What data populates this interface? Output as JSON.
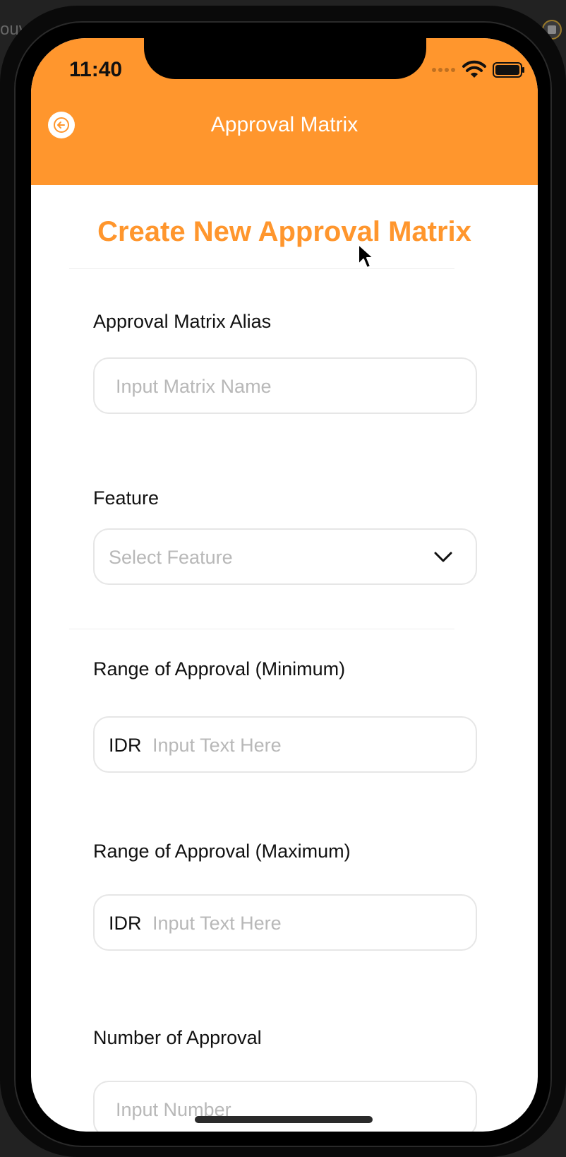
{
  "desktop": {
    "partial_text": "ouv"
  },
  "status_bar": {
    "time": "11:40"
  },
  "header": {
    "title": "Approval Matrix",
    "back_icon": "arrow-left-icon",
    "background_color": "#FF962D"
  },
  "page": {
    "title": "Create New Approval Matrix",
    "accent_color": "#FF962D"
  },
  "form": {
    "alias": {
      "label": "Approval Matrix Alias",
      "placeholder": "Input Matrix Name",
      "value": ""
    },
    "feature": {
      "label": "Feature",
      "placeholder": "Select Feature",
      "icon": "chevron-down-icon",
      "selected": ""
    },
    "range_min": {
      "label": "Range of Approval (Minimum)",
      "prefix": "IDR",
      "placeholder": "Input Text Here",
      "value": ""
    },
    "range_max": {
      "label": "Range of Approval (Maximum)",
      "prefix": "IDR",
      "placeholder": "Input Text Here",
      "value": ""
    },
    "num_approval": {
      "label": "Number of Approval",
      "placeholder": "Input Number",
      "value": ""
    }
  }
}
